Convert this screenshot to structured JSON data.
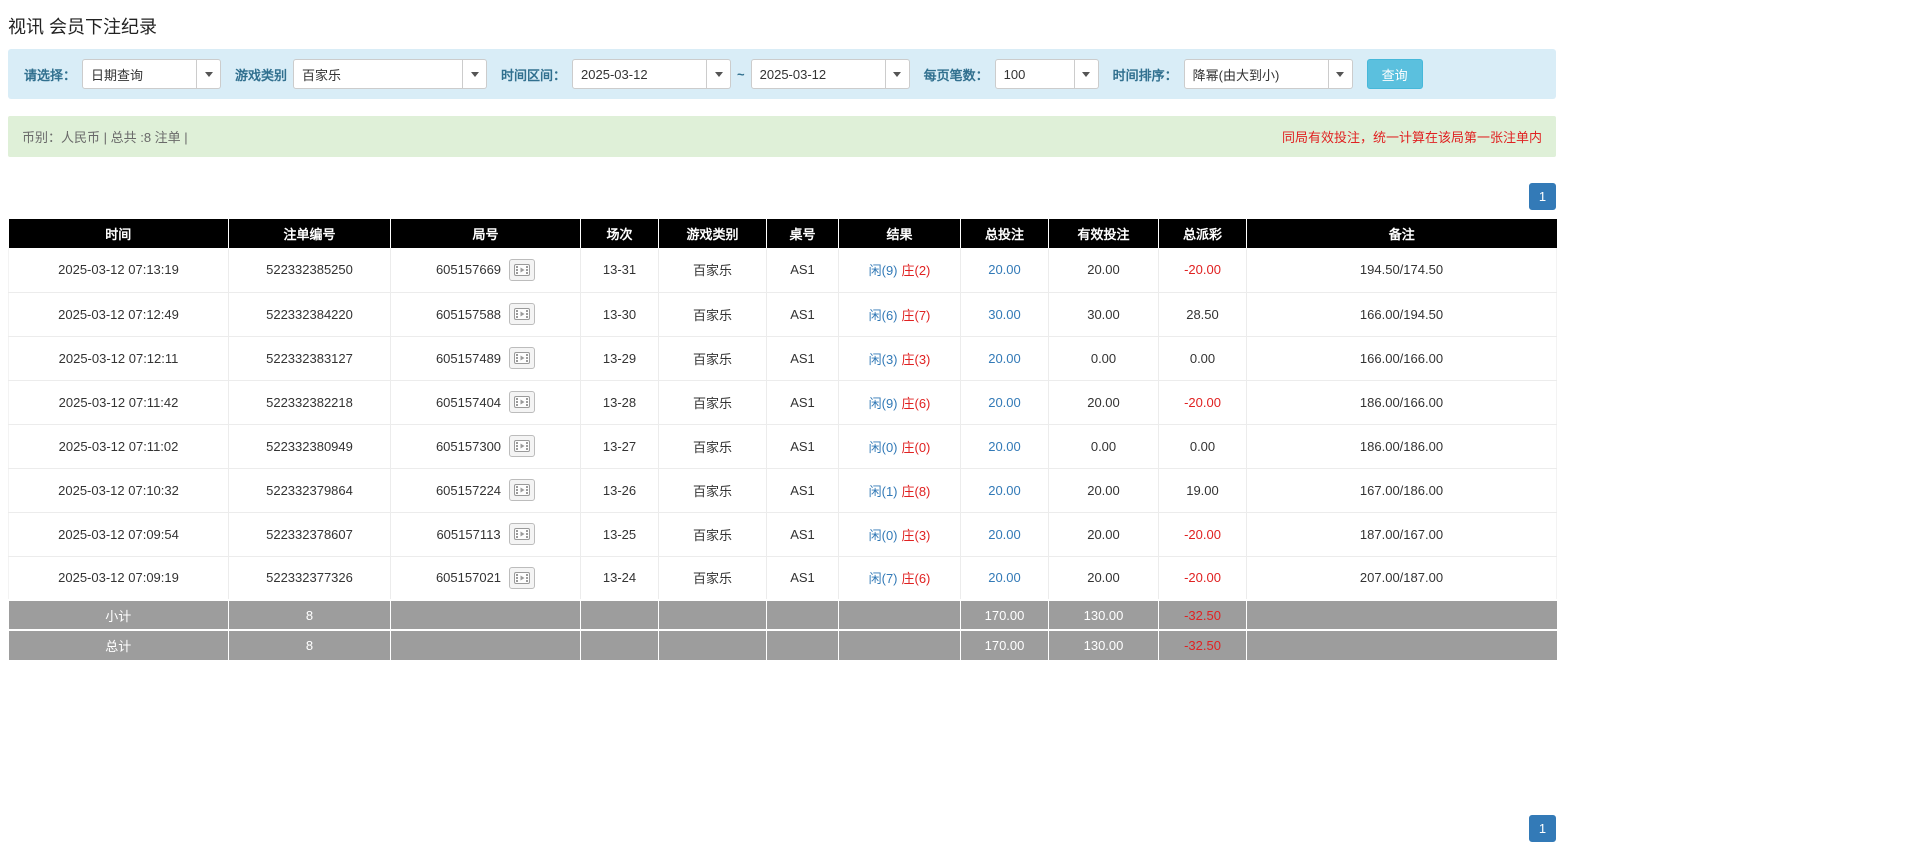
{
  "page": {
    "title": "视讯 会员下注纪录"
  },
  "icons": {
    "dropdown_caret": "caret-down-icon",
    "replay": "film-frame-icon"
  },
  "filters": {
    "select_label": "请选择：",
    "select_value": "日期查询",
    "game_type_label": "游戏类别",
    "game_type_value": "百家乐",
    "time_range_label": "时间区间：",
    "date_from": "2025-03-12",
    "tilde": "~",
    "date_to": "2025-03-12",
    "per_page_label": "每页笔数：",
    "per_page_value": "100",
    "sort_label": "时间排序：",
    "sort_value": "降幂(由大到小)",
    "search_button": "查询"
  },
  "summary": {
    "left": "币别：人民币 | 总共 :8 注单 |",
    "right": "同局有效投注，统一计算在该局第一张注单内"
  },
  "pagination": {
    "page": "1"
  },
  "table": {
    "headers": [
      "时间",
      "注单编号",
      "局号",
      "场次",
      "游戏类别",
      "桌号",
      "结果",
      "总投注",
      "有效投注",
      "总派彩",
      "备注"
    ],
    "rows": [
      {
        "time": "2025-03-12 07:13:19",
        "bet_id": "522332385250",
        "round": "605157669",
        "session": "13-31",
        "game": "百家乐",
        "table_no": "AS1",
        "result_player": "闲(9)",
        "result_banker": "庄(2)",
        "total_bet": "20.00",
        "valid_bet": "20.00",
        "payout": "-20.00",
        "remark": "194.50/174.50"
      },
      {
        "time": "2025-03-12 07:12:49",
        "bet_id": "522332384220",
        "round": "605157588",
        "session": "13-30",
        "game": "百家乐",
        "table_no": "AS1",
        "result_player": "闲(6)",
        "result_banker": "庄(7)",
        "total_bet": "30.00",
        "valid_bet": "30.00",
        "payout": "28.50",
        "remark": "166.00/194.50"
      },
      {
        "time": "2025-03-12 07:12:11",
        "bet_id": "522332383127",
        "round": "605157489",
        "session": "13-29",
        "game": "百家乐",
        "table_no": "AS1",
        "result_player": "闲(3)",
        "result_banker": "庄(3)",
        "total_bet": "20.00",
        "valid_bet": "0.00",
        "payout": "0.00",
        "remark": "166.00/166.00"
      },
      {
        "time": "2025-03-12 07:11:42",
        "bet_id": "522332382218",
        "round": "605157404",
        "session": "13-28",
        "game": "百家乐",
        "table_no": "AS1",
        "result_player": "闲(9)",
        "result_banker": "庄(6)",
        "total_bet": "20.00",
        "valid_bet": "20.00",
        "payout": "-20.00",
        "remark": "186.00/166.00"
      },
      {
        "time": "2025-03-12 07:11:02",
        "bet_id": "522332380949",
        "round": "605157300",
        "session": "13-27",
        "game": "百家乐",
        "table_no": "AS1",
        "result_player": "闲(0)",
        "result_banker": "庄(0)",
        "total_bet": "20.00",
        "valid_bet": "0.00",
        "payout": "0.00",
        "remark": "186.00/186.00"
      },
      {
        "time": "2025-03-12 07:10:32",
        "bet_id": "522332379864",
        "round": "605157224",
        "session": "13-26",
        "game": "百家乐",
        "table_no": "AS1",
        "result_player": "闲(1)",
        "result_banker": "庄(8)",
        "total_bet": "20.00",
        "valid_bet": "20.00",
        "payout": "19.00",
        "remark": "167.00/186.00"
      },
      {
        "time": "2025-03-12 07:09:54",
        "bet_id": "522332378607",
        "round": "605157113",
        "session": "13-25",
        "game": "百家乐",
        "table_no": "AS1",
        "result_player": "闲(0)",
        "result_banker": "庄(3)",
        "total_bet": "20.00",
        "valid_bet": "20.00",
        "payout": "-20.00",
        "remark": "187.00/167.00"
      },
      {
        "time": "2025-03-12 07:09:19",
        "bet_id": "522332377326",
        "round": "605157021",
        "session": "13-24",
        "game": "百家乐",
        "table_no": "AS1",
        "result_player": "闲(7)",
        "result_banker": "庄(6)",
        "total_bet": "20.00",
        "valid_bet": "20.00",
        "payout": "-20.00",
        "remark": "207.00/187.00"
      }
    ],
    "subtotal": {
      "label": "小计",
      "count": "8",
      "total_bet": "170.00",
      "valid_bet": "130.00",
      "payout": "-32.50",
      "remark": ""
    },
    "total": {
      "label": "总计",
      "count": "8",
      "total_bet": "170.00",
      "valid_bet": "130.00",
      "payout": "-32.50",
      "remark": ""
    }
  }
}
